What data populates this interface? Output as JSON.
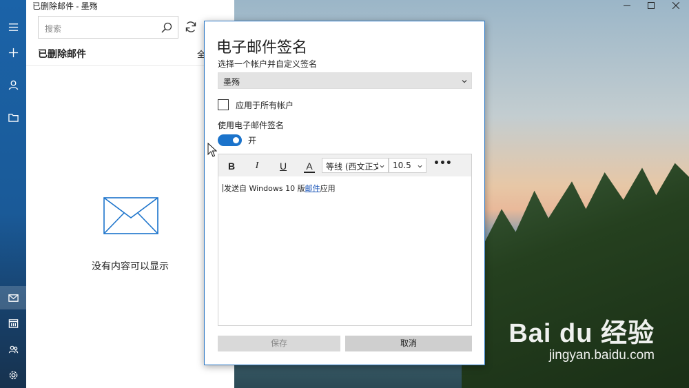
{
  "window": {
    "title": "已删除邮件 - 墨殇"
  },
  "nav": {
    "items": [
      {
        "icon": "menu-icon"
      },
      {
        "icon": "new-mail-icon"
      },
      {
        "icon": "account-icon"
      },
      {
        "icon": "folder-icon"
      },
      {
        "icon": "mail-icon",
        "active": true
      },
      {
        "icon": "calendar-icon"
      },
      {
        "icon": "people-icon"
      },
      {
        "icon": "settings-icon"
      }
    ]
  },
  "pane": {
    "search_placeholder": "搜索",
    "folder_title": "已删除邮件",
    "select_all": "全",
    "empty_message": "没有内容可以显示"
  },
  "dialog": {
    "title": "电子邮件签名",
    "choose_account_label": "选择一个帐户并自定义签名",
    "account_value": "墨殇",
    "apply_all_label": "应用于所有帐户",
    "apply_all_checked": false,
    "use_signature_label": "使用电子邮件签名",
    "toggle_on": true,
    "toggle_state_label": "开",
    "toolbar": {
      "bold": "B",
      "italic": "I",
      "underline": "U",
      "font_color": "A",
      "font_family": "等线 (西文正文)",
      "font_size": "10.5",
      "more": "•••"
    },
    "signature": {
      "prefix": "发送自 Windows 10 版",
      "link": "邮件",
      "suffix": "应用"
    },
    "save_label": "保存",
    "cancel_label": "取消"
  },
  "watermark": {
    "logo": "Bai du 经验",
    "url": "jingyan.baidu.com"
  },
  "colors": {
    "accent": "#1b73cb",
    "nav": "#1b63a8",
    "link": "#1a55b8"
  }
}
